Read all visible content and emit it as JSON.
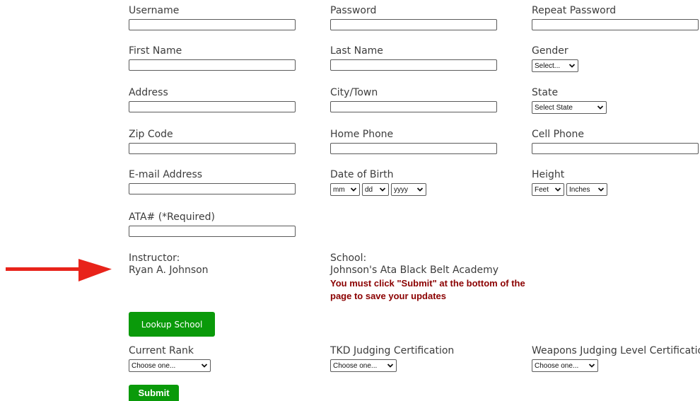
{
  "fields": {
    "username": {
      "label": "Username",
      "value": ""
    },
    "password": {
      "label": "Password",
      "value": ""
    },
    "repeat_password": {
      "label": "Repeat Password",
      "value": ""
    },
    "first_name": {
      "label": "First Name",
      "value": ""
    },
    "last_name": {
      "label": "Last Name",
      "value": ""
    },
    "gender": {
      "label": "Gender",
      "selected": "Select..."
    },
    "address": {
      "label": "Address",
      "value": ""
    },
    "city": {
      "label": "City/Town",
      "value": ""
    },
    "state": {
      "label": "State",
      "selected": "Select State"
    },
    "zip": {
      "label": "Zip Code",
      "value": ""
    },
    "home_phone": {
      "label": "Home Phone",
      "value": ""
    },
    "cell_phone": {
      "label": "Cell Phone",
      "value": ""
    },
    "email": {
      "label": "E-mail Address",
      "value": ""
    },
    "dob": {
      "label": "Date of Birth",
      "month": "mm",
      "day": "dd",
      "year": "yyyy"
    },
    "height": {
      "label": "Height",
      "feet": "Feet",
      "inches": "Inches"
    },
    "ata": {
      "label": "ATA# (*Required)",
      "value": ""
    }
  },
  "instructor": {
    "label": "Instructor:",
    "name": "Ryan A. Johnson"
  },
  "school": {
    "label": "School:",
    "name": "Johnson's Ata Black Belt Academy",
    "warning": "You must click \"Submit\" at the bottom of the page to save your updates"
  },
  "lookup_button": "Lookup School",
  "current_rank": {
    "label": "Current Rank",
    "selected": "Choose one..."
  },
  "tkd_judging": {
    "label": "TKD Judging Certification",
    "selected": "Choose one..."
  },
  "weapons_judging": {
    "label": "Weapons Judging Level Certification",
    "selected": "Choose one..."
  },
  "submit_button": "Submit",
  "colors": {
    "button_green": "#0a9a0a",
    "warning_red": "#8b0000",
    "arrow_red": "#e8231a"
  },
  "icons": {
    "select_arrow": "chevron-down-icon",
    "pointer": "arrow-right-icon"
  }
}
